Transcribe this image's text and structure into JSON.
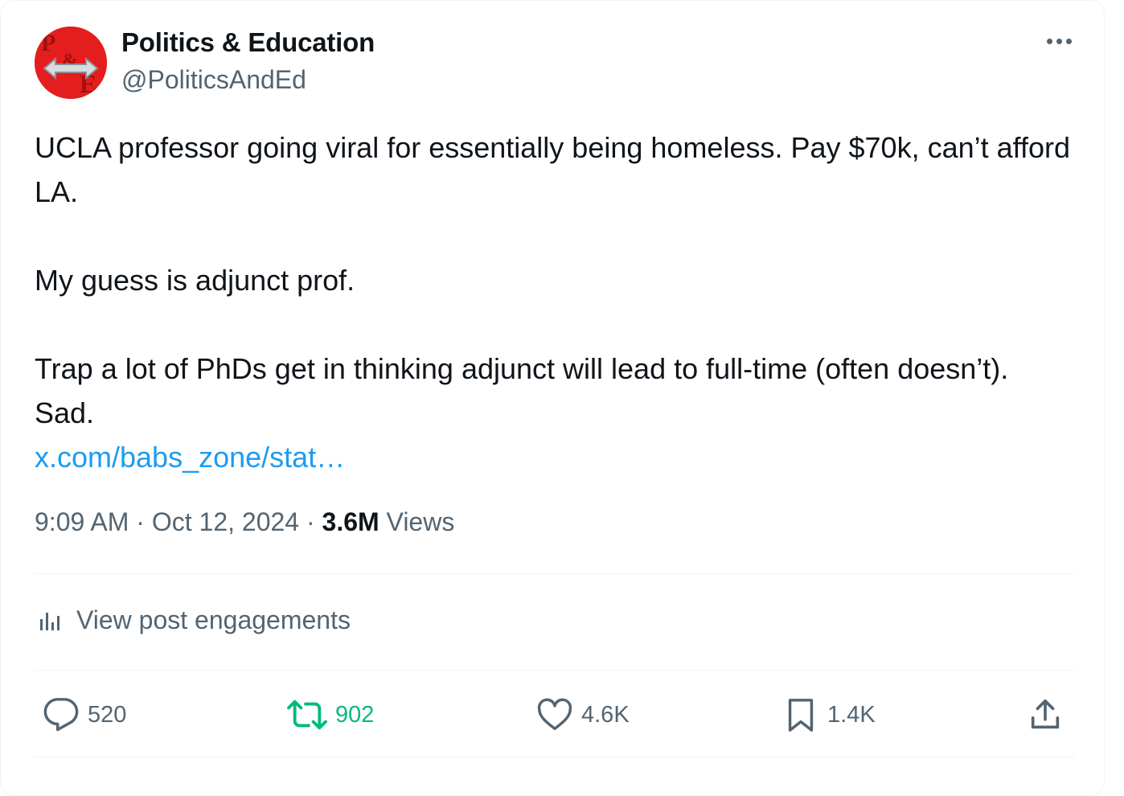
{
  "post": {
    "author": {
      "name": "Politics & Education",
      "handle": "@PoliticsAndEd",
      "avatar_colors": {
        "background": "#e41e1e",
        "letters": "#a30f0f",
        "arrows": "#8a8f96"
      }
    },
    "text": {
      "paragraph1": "UCLA professor going viral for essentially being homeless. Pay $70k, can’t afford LA.",
      "paragraph2": "My guess is adjunct prof.",
      "paragraph3": "Trap a lot of PhDs get in thinking adjunct will lead to full-time (often doesn’t). Sad.",
      "link": "x.com/babs_zone/stat…"
    },
    "meta": {
      "time": "9:09 AM",
      "separator": "·",
      "date": "Oct 12, 2024",
      "views_count": "3.6M",
      "views_label": "Views"
    },
    "engagements_label": "View post engagements",
    "actions": {
      "replies": "520",
      "reposts": "902",
      "likes": "4.6K",
      "bookmarks": "1.4K"
    }
  },
  "icons": {
    "more": "more-horizontal-icon",
    "analytics": "bar-chart-icon",
    "reply": "speech-bubble-icon",
    "repost": "repost-arrows-icon",
    "like": "heart-icon",
    "bookmark": "bookmark-icon",
    "share": "share-upload-icon"
  },
  "colors": {
    "text_primary": "#0f1419",
    "text_secondary": "#536471",
    "link": "#1d9bf0",
    "repost_green": "#00ba7c",
    "divider": "#eff3f4"
  }
}
